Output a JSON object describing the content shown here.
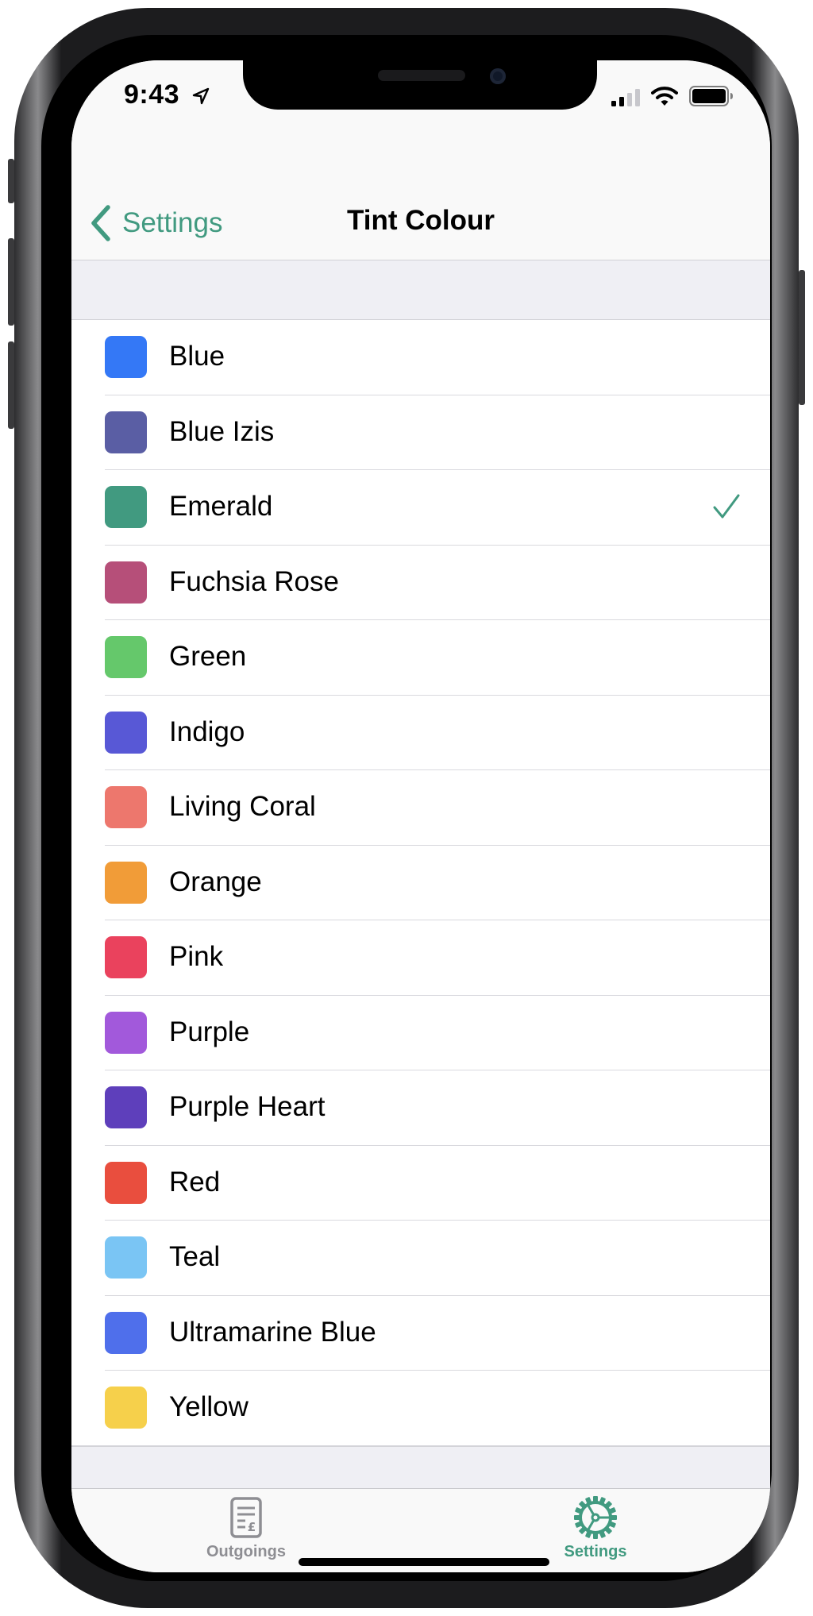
{
  "status_bar": {
    "time": "9:43",
    "icons": [
      "location-arrow-icon",
      "cellular-signal-icon",
      "wifi-icon",
      "battery-icon"
    ]
  },
  "nav": {
    "back_label": "Settings",
    "title": "Tint Colour"
  },
  "colours": {
    "selected": "Emerald",
    "items": [
      {
        "label": "Blue",
        "color": "#3478f6"
      },
      {
        "label": "Blue Izis",
        "color": "#5a5ea4"
      },
      {
        "label": "Emerald",
        "color": "#419a80"
      },
      {
        "label": "Fuchsia Rose",
        "color": "#b64f79"
      },
      {
        "label": "Green",
        "color": "#65c86b"
      },
      {
        "label": "Indigo",
        "color": "#5858d6"
      },
      {
        "label": "Living Coral",
        "color": "#ed776d"
      },
      {
        "label": "Orange",
        "color": "#f19c38"
      },
      {
        "label": "Pink",
        "color": "#ea425d"
      },
      {
        "label": "Purple",
        "color": "#a259db"
      },
      {
        "label": "Purple Heart",
        "color": "#5e3fbb"
      },
      {
        "label": "Red",
        "color": "#e94e3e"
      },
      {
        "label": "Teal",
        "color": "#7ac5f4"
      },
      {
        "label": "Ultramarine Blue",
        "color": "#4f6feb"
      },
      {
        "label": "Yellow",
        "color": "#f6d04b"
      }
    ]
  },
  "tab_bar": {
    "tabs": [
      {
        "label": "Outgoings",
        "icon": "document-pound-icon",
        "active": false
      },
      {
        "label": "Settings",
        "icon": "gear-icon",
        "active": true
      }
    ],
    "active_color": "#419a80",
    "inactive_color": "#8e8e93"
  }
}
